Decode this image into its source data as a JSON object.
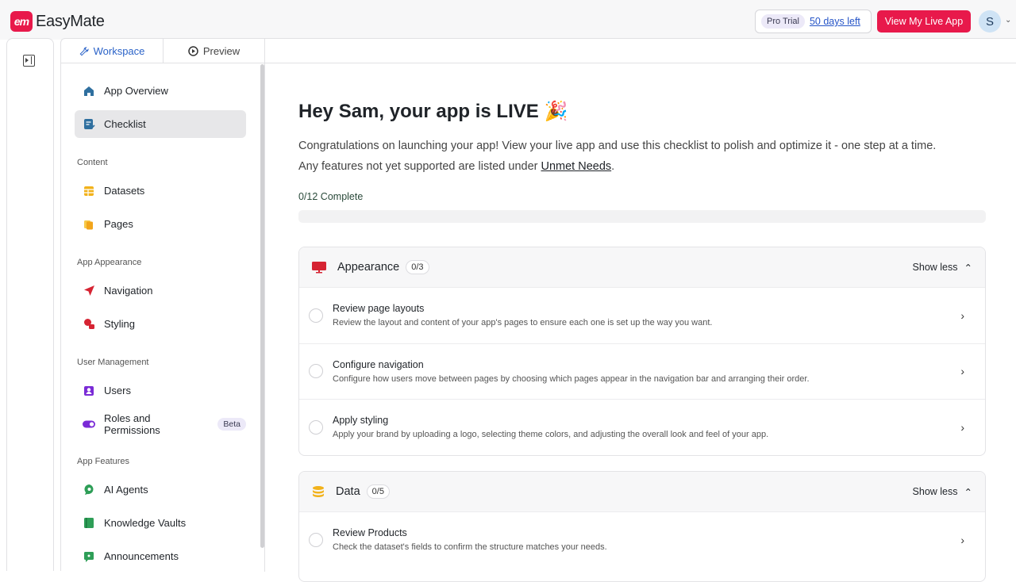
{
  "app": {
    "name": "EasyMate",
    "logo_mark": "em"
  },
  "header": {
    "trial_badge": "Pro Trial",
    "days_left": "50 days left",
    "live_button": "View My Live App",
    "avatar_initial": "S"
  },
  "tabs": [
    {
      "label": "Workspace"
    },
    {
      "label": "Preview"
    }
  ],
  "sidebar": {
    "top_items": [
      {
        "label": "App Overview"
      },
      {
        "label": "Checklist"
      }
    ],
    "sections": [
      {
        "title": "Content",
        "items": [
          {
            "label": "Datasets"
          },
          {
            "label": "Pages"
          }
        ]
      },
      {
        "title": "App Appearance",
        "items": [
          {
            "label": "Navigation"
          },
          {
            "label": "Styling"
          }
        ]
      },
      {
        "title": "User Management",
        "items": [
          {
            "label": "Users"
          },
          {
            "label": "Roles and Permissions",
            "badge": "Beta"
          }
        ]
      },
      {
        "title": "App Features",
        "items": [
          {
            "label": "AI Agents"
          },
          {
            "label": "Knowledge Vaults"
          },
          {
            "label": "Announcements"
          }
        ]
      }
    ]
  },
  "main": {
    "greeting": "Hey Sam, your app is LIVE",
    "greeting_emoji": "🎉",
    "description_1": "Congratulations on launching your app! View your live app and use this checklist to polish and optimize it - one step at a time.",
    "description_2_prefix": "Any features not yet supported are listed under ",
    "description_2_link": "Unmet Needs",
    "description_2_suffix": ".",
    "progress_label": "0/12 Complete",
    "progress_fraction": 0,
    "show_less": "Show less",
    "cards": [
      {
        "title": "Appearance",
        "count": "0/3",
        "rows": [
          {
            "title": "Review page layouts",
            "sub": "Review the layout and content of your app's pages to ensure each one is set up the way you want."
          },
          {
            "title": "Configure navigation",
            "sub": "Configure how users move between pages by choosing which pages appear in the navigation bar and arranging their order."
          },
          {
            "title": "Apply styling",
            "sub": "Apply your brand by uploading a logo, selecting theme colors, and adjusting the overall look and feel of your app."
          }
        ]
      },
      {
        "title": "Data",
        "count": "0/5",
        "rows": [
          {
            "title": "Review Products",
            "sub": "Check the dataset's fields to confirm the structure matches your needs."
          }
        ]
      }
    ]
  },
  "colors": {
    "brand": "#e8194b",
    "link": "#2554c7",
    "accent_tab": "#2b63c8"
  }
}
